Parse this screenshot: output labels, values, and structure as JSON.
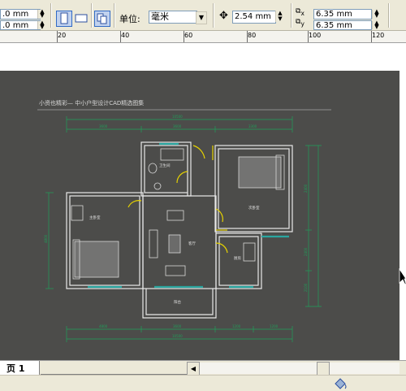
{
  "propbar": {
    "left_field_top": ".0 mm",
    "left_field_bottom": ".0 mm",
    "unit_label": "单位:",
    "unit_value": "毫米",
    "nudge_value": "2.54 mm",
    "dup_x_value": "6.35 mm",
    "dup_y_value": "6.35 mm",
    "x_label": "x",
    "y_label": "y"
  },
  "ruler": {
    "labels": [
      "20",
      "40",
      "60",
      "80",
      "100",
      "120"
    ]
  },
  "drawing": {
    "title": "小资也精彩— 中小户型设计CAD精选图集",
    "rooms": {
      "bathroom": "卫生间",
      "bedroom_right": "次卧室",
      "bedroom_left": "主卧室",
      "living": "客厅",
      "kitchen": "厨房",
      "balcony": "阳台"
    },
    "dims_top_total": "10500",
    "dims_top": [
      "3600",
      "3600",
      "3300"
    ],
    "dims_bottom_total": "10500",
    "dims_bottom": [
      "4800",
      "3600",
      "1200",
      "1200"
    ],
    "dims_left": "4800",
    "dims_right": [
      "2400",
      "2400",
      "2100"
    ]
  },
  "tabs": {
    "page_tab": "页 1"
  },
  "colors": {
    "page_bg": "#4c4c4a",
    "wall": "#e8e8e8",
    "dimension": "#1fa05a",
    "door": "#e6d200",
    "window": "#2aa6a0"
  }
}
